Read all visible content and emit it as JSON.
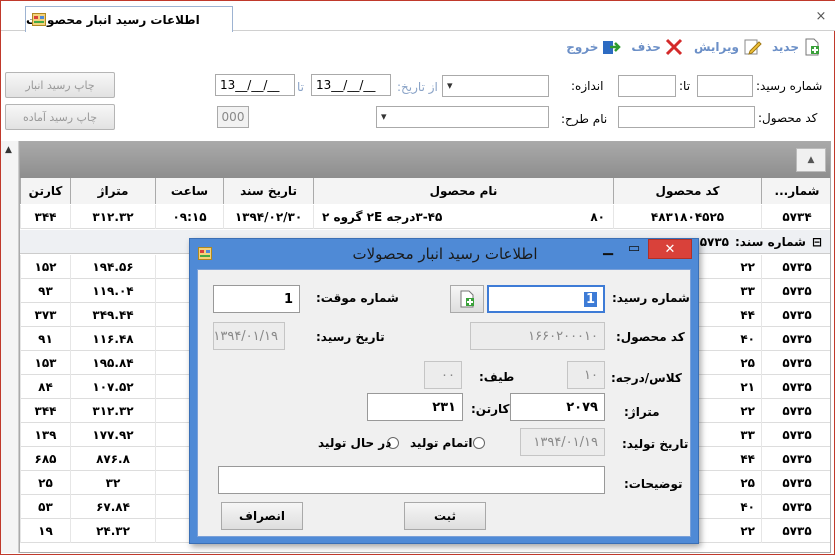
{
  "window": {
    "tab_title": "اطلاعات رسید انبار محصولات",
    "close_glyph": "×"
  },
  "toolbar": {
    "new_label": "جدید",
    "edit_label": "ویرایش",
    "delete_label": "حذف",
    "exit_label": "خروج"
  },
  "filters": {
    "receipt_no_label": "شماره رسید:",
    "to_label": "تا:",
    "size_label": "اندازه:",
    "from_date_label": "از تاریخ:",
    "from_date_value": "13__/__/__",
    "to_date_label": "تا",
    "to_date_value": "13__/__/__",
    "print_stock_receipt": "چاپ رسید انبار",
    "product_code_label": "کد محصول:",
    "design_name_label": "نام طرح:",
    "counter_value": "000",
    "print_ready_receipt": "چاپ رسید آماده"
  },
  "grid": {
    "columns": [
      "شمار...",
      "کد محصول",
      "نام محصول",
      "تاریخ سند",
      "ساعت",
      "متراژ",
      "کارتن"
    ],
    "first_row": {
      "doc_no": "۵۷۳۴",
      "product_code": "۴۸۳۱۸۰۴۵۲۵",
      "product_name": "۳-۴۵درجه ۲E گروه ۲",
      "product_name_suffix": "۸۰",
      "date": "۱۳۹۴/۰۲/۳۰",
      "time": "۰۹:۱۵",
      "meterage": "۳۱۲.۳۲",
      "carton": "۳۴۴"
    },
    "group_label": "شماره سند:",
    "group_value": "۵۷۳۵",
    "rows": [
      {
        "doc": "۵۷۳۵",
        "code_tail": "۲۲",
        "meterage": "۱۹۴.۵۶",
        "carton": "۱۵۲"
      },
      {
        "doc": "۵۷۳۵",
        "code_tail": "۳۳",
        "meterage": "۱۱۹.۰۴",
        "carton": "۹۳"
      },
      {
        "doc": "۵۷۳۵",
        "code_tail": "۴۴",
        "meterage": "۳۴۹.۴۴",
        "carton": "۳۷۳"
      },
      {
        "doc": "۵۷۳۵",
        "code_tail": "۴۰",
        "meterage": "۱۱۶.۴۸",
        "carton": "۹۱"
      },
      {
        "doc": "۵۷۳۵",
        "code_tail": "۲۵",
        "meterage": "۱۹۵.۸۴",
        "carton": "۱۵۳"
      },
      {
        "doc": "۵۷۳۵",
        "code_tail": "۲۱",
        "meterage": "۱۰۷.۵۲",
        "carton": "۸۴"
      },
      {
        "doc": "۵۷۳۵",
        "code_tail": "۲۲",
        "meterage": "۳۱۲.۳۲",
        "carton": "۳۴۴"
      },
      {
        "doc": "۵۷۳۵",
        "code_tail": "۳۳",
        "meterage": "۱۷۷.۹۲",
        "carton": "۱۳۹"
      },
      {
        "doc": "۵۷۳۵",
        "code_tail": "۴۴",
        "meterage": "۸۷۶.۸",
        "carton": "۶۸۵"
      },
      {
        "doc": "۵۷۳۵",
        "code_tail": "۲۵",
        "meterage": "۳۲",
        "carton": "۲۵"
      },
      {
        "doc": "۵۷۳۵",
        "code_tail": "۴۰",
        "meterage": "۶۷.۸۴",
        "carton": "۵۳"
      },
      {
        "doc": "۵۷۳۵",
        "code_tail": "۲۲",
        "meterage": "۲۴.۳۲",
        "carton": "۱۹"
      }
    ]
  },
  "dialog": {
    "title": "اطلاعات رسید انبار محصولات",
    "receipt_no_label": "شماره رسید:",
    "receipt_no_value": "1",
    "temp_no_label": "شماره موقت:",
    "temp_no_value": "1",
    "product_code_label": "کد محصول:",
    "product_code_value": "۱۶۶۰۲۰۰۰۱۰",
    "receipt_date_label": "تاریخ رسید:",
    "receipt_date_value": "۱۳۹۴/۰۱/۱۹",
    "class_label": "کلاس/درجه:",
    "class_value": "۱۰",
    "shade_label": "طیف:",
    "shade_value": "۰۰",
    "meterage_label": "متراژ:",
    "meterage_value": "۲۰۷۹",
    "carton_label": "کارتن:",
    "carton_value": "۲۳۱",
    "prod_date_label": "تاریخ تولید:",
    "prod_date_value": "۱۳۹۴/۰۱/۱۹",
    "radio_finished": "اتمام تولید",
    "radio_in_progress": "در حال تولید",
    "notes_label": "توضیحات:",
    "notes_value": "",
    "save_button": "ثبت",
    "cancel_button": "انصراف"
  }
}
